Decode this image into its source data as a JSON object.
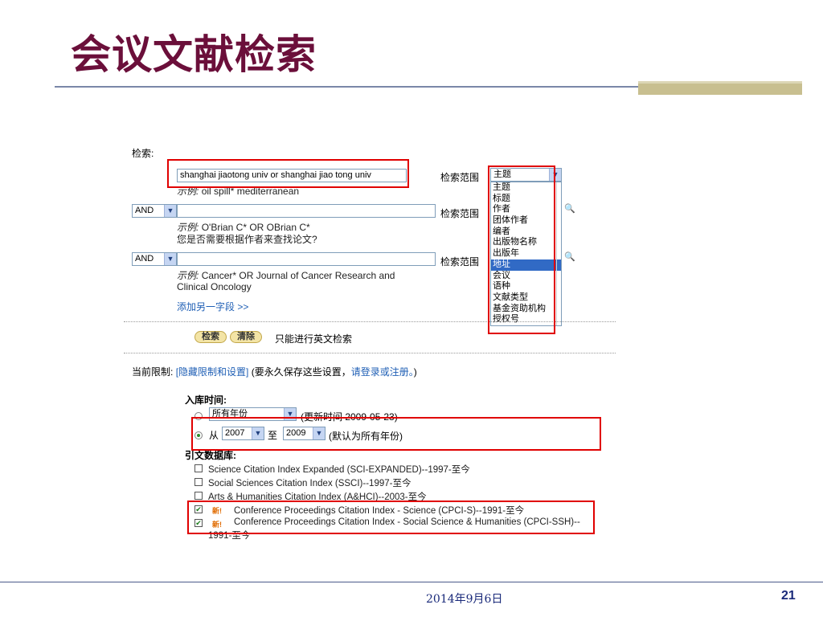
{
  "slide": {
    "title": "会议文献检索",
    "date": "2014年9月6日",
    "page_number": "21"
  },
  "search": {
    "heading": "检索:",
    "field1_value": "shanghai jiaotong univ or shanghai jiao tong univ",
    "field1_example_prefix": "示例:",
    "field1_example": "oil spill* mediterranean",
    "scope_label": "检索范围",
    "scope_selected": "主题",
    "operator2": "AND",
    "field2_value": "",
    "field2_example_prefix": "示例:",
    "field2_example": "O'Brian C* OR OBrian C*",
    "field2_help": "您是否需要根据作者来查找论文?",
    "operator3": "AND",
    "field3_value": "",
    "field3_example_prefix": "示例:",
    "field3_example_line1": "Cancer* OR Journal of Cancer Research and",
    "field3_example_line2": "Clinical Oncology",
    "add_field_link": "添加另一字段 >>",
    "search_button": "检索",
    "clear_button": "清除",
    "english_only": "只能进行英文检索"
  },
  "scope_options": [
    "主题",
    "标题",
    "作者",
    "团体作者",
    "编者",
    "出版物名称",
    "出版年",
    "地址",
    "会议",
    "语种",
    "文献类型",
    "基金资助机构",
    "授权号"
  ],
  "scope_highlighted_index": 7,
  "limits": {
    "current_label": "当前限制:",
    "hide_link": "[隐藏限制和设置]",
    "save_prefix": "(要永久保存这些设置，",
    "login_link": "请登录或注册。",
    "save_suffix": ")",
    "timespan_heading": "入库时间:",
    "all_years_select": "所有年份",
    "updated_note": "(更新时间 2009-05-23)",
    "from_label": "从",
    "from_year": "2007",
    "to_label": "至",
    "to_year": "2009",
    "default_note": "(默认为所有年份)",
    "citation_db_heading": "引文数据库:"
  },
  "databases": [
    {
      "label": "Science Citation Index Expanded (SCI-EXPANDED)--1997-至今",
      "checked": false,
      "new": false
    },
    {
      "label": "Social Sciences Citation Index (SSCI)--1997-至今",
      "checked": false,
      "new": false
    },
    {
      "label": "Arts & Humanities Citation Index (A&HCI)--2003-至今",
      "checked": false,
      "new": false
    },
    {
      "label": "Conference Proceedings Citation Index - Science (CPCI-S)--1991-至今",
      "checked": true,
      "new": true
    },
    {
      "label": "Conference Proceedings Citation Index - Social Science & Humanities (CPCI-SSH)--",
      "checked": true,
      "new": true,
      "continuation": "1991-至今"
    }
  ],
  "new_badge": "新!",
  "colors": {
    "title": "#6b0f3a",
    "highlight_box": "#e00000",
    "link": "#1f5fb5",
    "list_selected": "#316ac5"
  }
}
